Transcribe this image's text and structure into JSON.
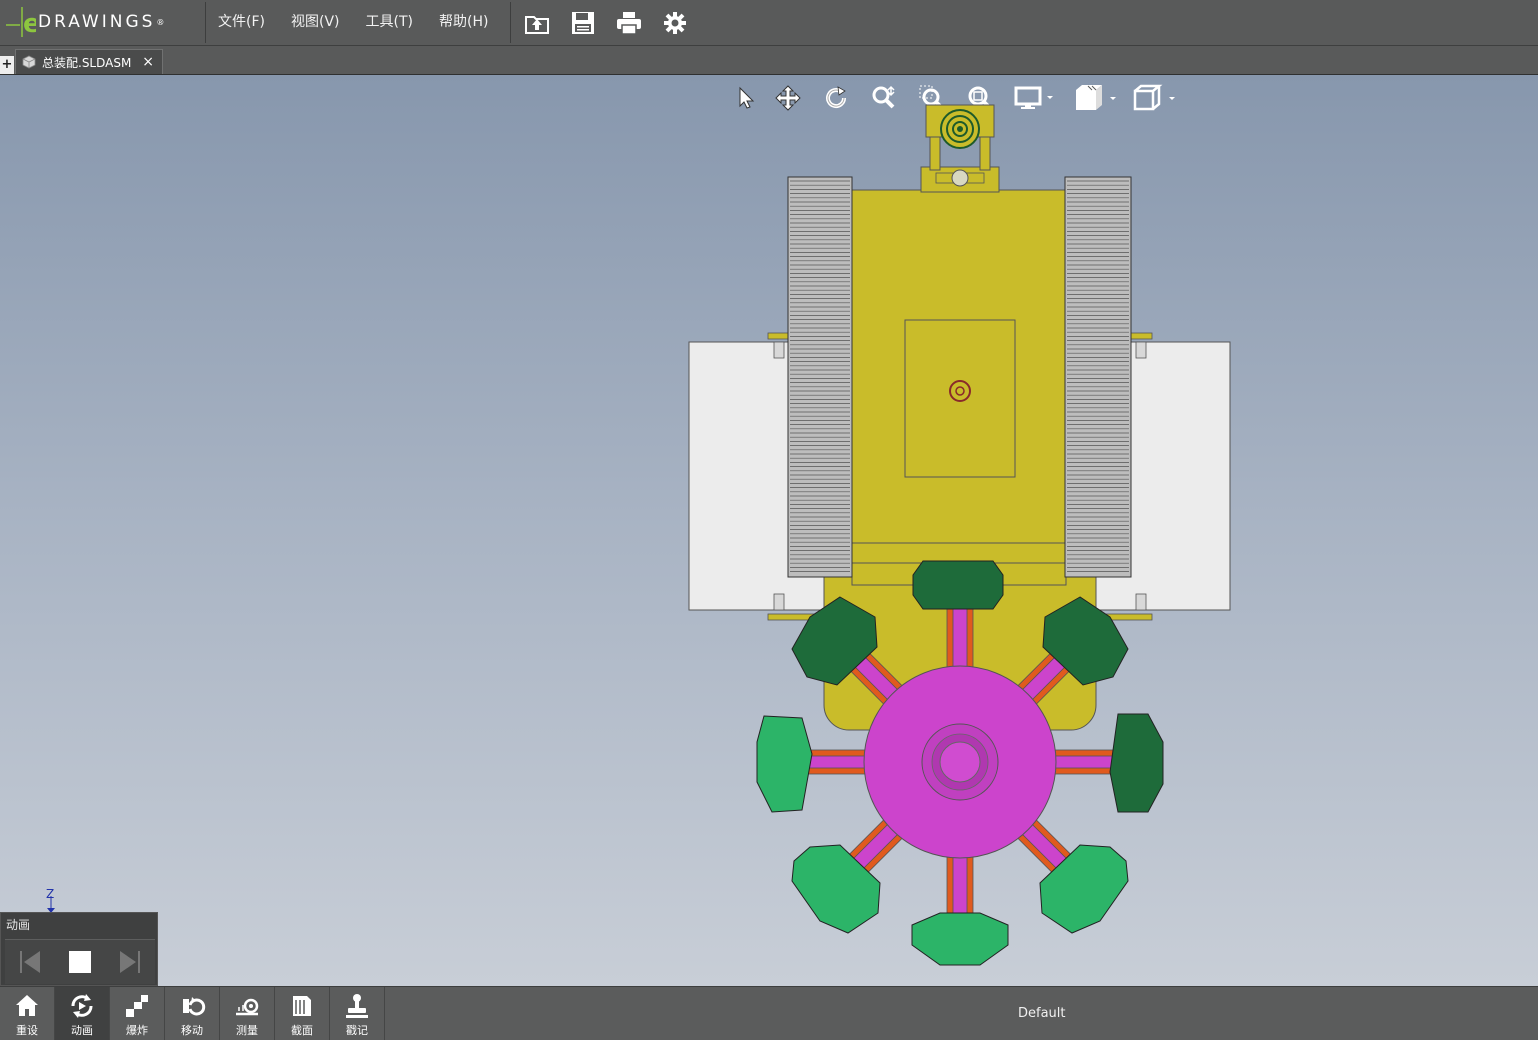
{
  "app": {
    "logo_text": "DRAWINGS",
    "logo_mark": "e",
    "logo_reg": "®"
  },
  "menu": {
    "items": [
      "文件(F)",
      "视图(V)",
      "工具(T)",
      "帮助(H)"
    ]
  },
  "top_tools": [
    "open-icon",
    "save-icon",
    "print-icon",
    "settings-icon"
  ],
  "tabs": {
    "add_label": "+",
    "document": "总装配.SLDASM",
    "close": "×"
  },
  "view_toolbar": [
    "select-icon",
    "pan-icon",
    "rotate-icon",
    "zoom-icon",
    "zoom-to-area-icon",
    "zoom-to-fit-icon",
    "display-style-icon",
    "view-orientation-icon",
    "section-view-icon"
  ],
  "triad": {
    "axis_label": "Z"
  },
  "animation_panel": {
    "title": "动画",
    "controls": [
      "skip-back-icon",
      "stop-icon",
      "skip-forward-icon"
    ]
  },
  "bottom_toolbar": {
    "items": [
      {
        "label": "重设",
        "icon": "home-icon"
      },
      {
        "label": "动画",
        "icon": "animate-icon",
        "active": true
      },
      {
        "label": "爆炸",
        "icon": "explode-icon"
      },
      {
        "label": "移动",
        "icon": "move-icon"
      },
      {
        "label": "测量",
        "icon": "measure-icon"
      },
      {
        "label": "截面",
        "icon": "section-icon"
      },
      {
        "label": "戳记",
        "icon": "stamp-icon"
      }
    ],
    "configuration": "Default"
  },
  "colors": {
    "body_yellow": "#c9bc2a",
    "hub_magenta": "#cc44cc",
    "paddle_green": "#2cb468",
    "paddle_dark_green": "#1e6b3a",
    "arm_orange": "#e05a1e",
    "panel_white": "#ececec"
  }
}
